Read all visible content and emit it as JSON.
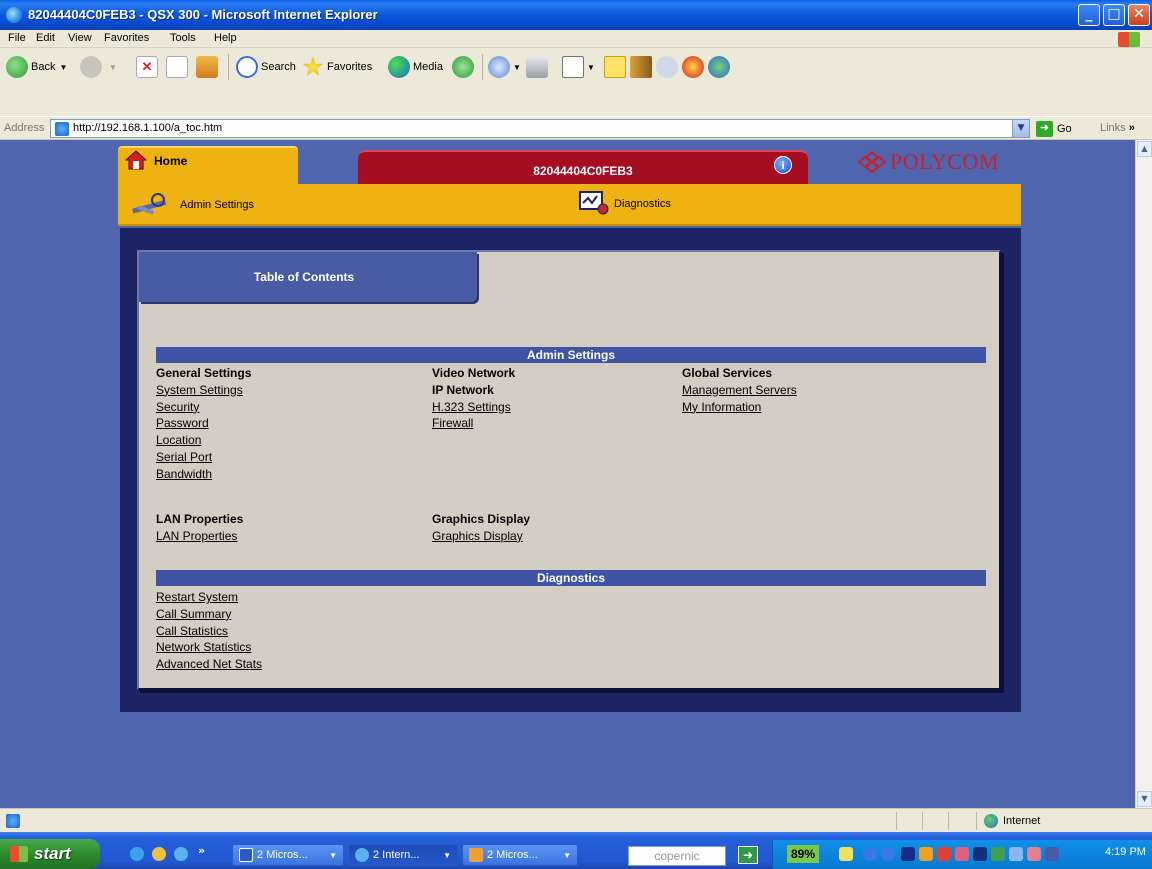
{
  "window": {
    "title": "82044404C0FEB3 - QSX 300 - Microsoft Internet Explorer",
    "controls": [
      "minimize",
      "maximize",
      "close"
    ]
  },
  "menubar": {
    "items": [
      "File",
      "Edit",
      "View",
      "Favorites",
      "Tools",
      "Help"
    ]
  },
  "toolbar": {
    "back_label": "Back",
    "search_label": "Search",
    "favorites_label": "Favorites",
    "media_label": "Media"
  },
  "addressbar": {
    "label": "Address",
    "url": "http://192.168.1.100/a_toc.htm",
    "go_label": "Go",
    "links_label": "Links",
    "links_chevron": "»"
  },
  "page": {
    "home_tab": "Home",
    "device_tab": "82044404C0FEB3",
    "info_glyph": "i",
    "brand": "POLYCOM",
    "nav": {
      "admin_settings": "Admin Settings",
      "diagnostics": "Diagnostics"
    },
    "toc_title": "Table of Contents",
    "admin_section": {
      "header": "Admin Settings",
      "general_heading": "General Settings",
      "general_links": [
        "System Settings",
        "Security",
        "Password",
        "Location",
        "Serial Port",
        "Bandwidth"
      ],
      "video_heading": "Video Network",
      "ip_heading": "IP Network",
      "ip_links": [
        "H.323 Settings",
        "Firewall"
      ],
      "global_heading": "Global Services",
      "global_links": [
        "Management Servers",
        "My Information"
      ],
      "lan_heading": "LAN Properties",
      "lan_links": [
        "LAN Properties"
      ],
      "graphics_heading": "Graphics Display",
      "graphics_links": [
        "Graphics Display"
      ]
    },
    "diagnostics_section": {
      "header": "Diagnostics",
      "links": [
        "Restart System",
        "Call Summary",
        "Call Statistics",
        "Network Statistics",
        "Advanced Net Stats"
      ]
    }
  },
  "statusbar": {
    "zone": "Internet"
  },
  "taskbar": {
    "start_label": "start",
    "overflow": "»",
    "buttons": [
      "2 Micros...",
      "2 Intern...",
      "2 Micros..."
    ],
    "search_placeholder": "copernic",
    "battery": "89%",
    "clock": "4:19 PM"
  },
  "colors": {
    "page_bg": "#4f65ae",
    "gold": "#eeb213",
    "device_tab": "#a60d20",
    "navy_frame": "#1c2466",
    "panel": "#d4cdc4",
    "section_header": "#3f53a4",
    "brand_red": "#c7202e"
  }
}
